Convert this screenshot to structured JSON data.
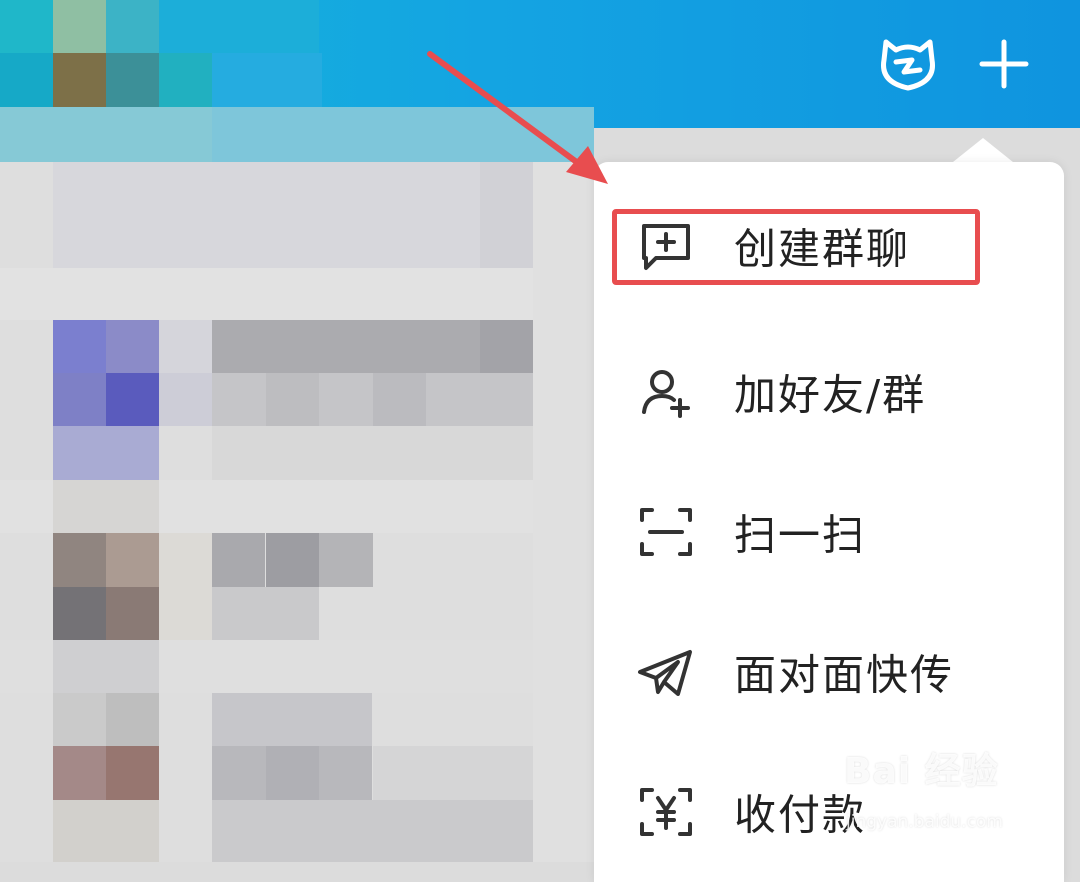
{
  "header": {
    "avatar_icon": "cat-face-icon",
    "add_icon": "plus-icon",
    "background": "#14a4e2"
  },
  "menu": {
    "items": [
      {
        "label": "创建群聊",
        "icon": "chat-plus-icon"
      },
      {
        "label": "加好友/群",
        "icon": "add-user-icon"
      },
      {
        "label": "扫一扫",
        "icon": "scan-icon"
      },
      {
        "label": "面对面快传",
        "icon": "paper-plane-icon"
      },
      {
        "label": "收付款",
        "icon": "yuan-scan-icon"
      }
    ],
    "highlight_color": "#e84d4f"
  },
  "watermark": {
    "brand": "Bai  经验",
    "url": "jingyan.baidu.com"
  }
}
